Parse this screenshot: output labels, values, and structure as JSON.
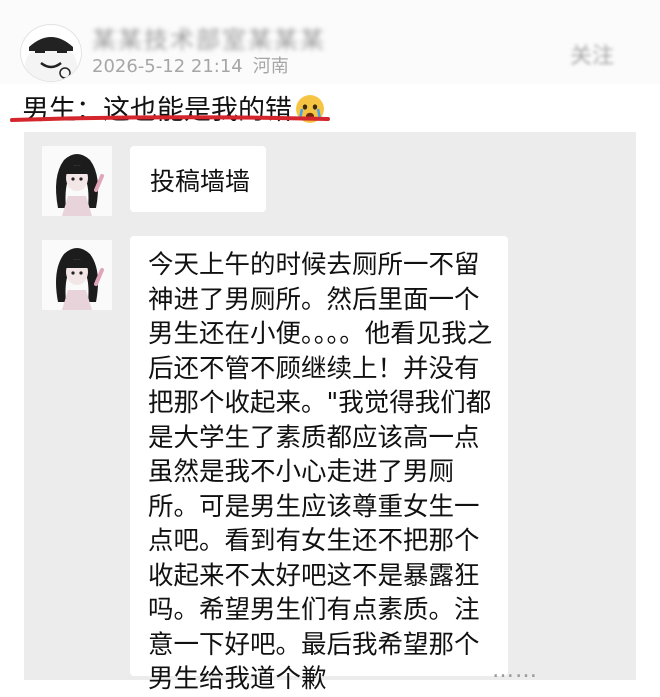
{
  "post": {
    "author_name": "某某技术部室某某某",
    "datetime": "2026-5-12 21:14",
    "location": "河南",
    "follow_label": "关注",
    "headline": "男生：这也能是我的错",
    "headline_emoji": "crying-face-icon"
  },
  "chat": {
    "messages": [
      {
        "text": "投稿墙墙"
      },
      {
        "text": "今天上午的时候去厕所一不留神进了男厕所。然后里面一个男生还在小便。。。。他看见我之后还不管不顾继续上！并没有把那个收起来。\"我觉得我们都是大学生了素质都应该高一点虽然是我不小心走进了男厕所。可是男生应该尊重女生一点吧。看到有女生还不把那个收起来不太好吧这不是暴露狂吗。希望男生们有点素质。注意一下好吧。最后我希望那个男生给我道个歉"
      }
    ]
  },
  "watermark": "……",
  "colors": {
    "underline": "#d4262c",
    "panel": "#ececed",
    "bubble": "#ffffff"
  }
}
